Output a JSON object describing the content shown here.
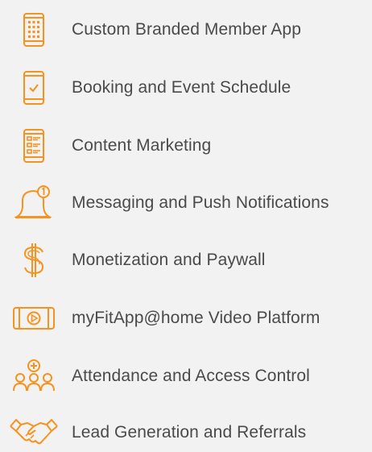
{
  "icon_color": "#f6921e",
  "text_color": "#4a4a4a",
  "background_color": "#f2f2f2",
  "features": [
    {
      "icon": "keypad-phone-icon",
      "label": "Custom Branded Member App"
    },
    {
      "icon": "checkmark-phone-icon",
      "label": "Booking and Event Schedule"
    },
    {
      "icon": "content-list-phone-icon",
      "label": "Content Marketing"
    },
    {
      "icon": "notification-bell-icon",
      "label": "Messaging and Push Notifications"
    },
    {
      "icon": "dollar-sign-icon",
      "label": "Monetization and Paywall"
    },
    {
      "icon": "video-play-icon",
      "label": "myFitApp@home Video Platform"
    },
    {
      "icon": "group-add-people-icon",
      "label": "Attendance and Access Control"
    },
    {
      "icon": "handshake-icon",
      "label": "Lead Generation and Referrals"
    }
  ]
}
